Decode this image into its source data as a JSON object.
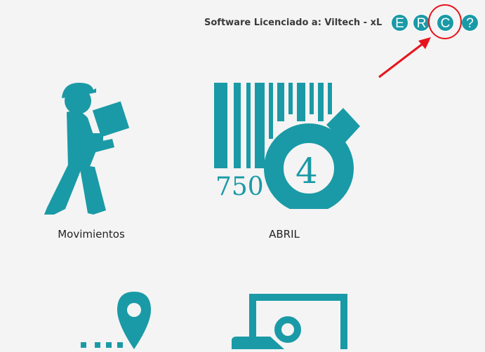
{
  "header": {
    "license_text": "Software Licenciado a: Viltech - xL",
    "buttons": [
      {
        "label": "E"
      },
      {
        "label": "R"
      },
      {
        "label": "C"
      },
      {
        "label": "?"
      }
    ]
  },
  "modules": [
    {
      "label": "Movimientos",
      "icon": "delivery-person-icon"
    },
    {
      "label": "ABRIL",
      "icon": "barcode-icon",
      "barcode_number": "750",
      "badge_number": "4"
    },
    {
      "label": "",
      "icon": "location-pin-icon"
    },
    {
      "label": "",
      "icon": "image-frame-icon"
    }
  ],
  "colors": {
    "accent": "#1a9aa6",
    "annotation": "#e8141c",
    "background": "#f4f4f4"
  }
}
